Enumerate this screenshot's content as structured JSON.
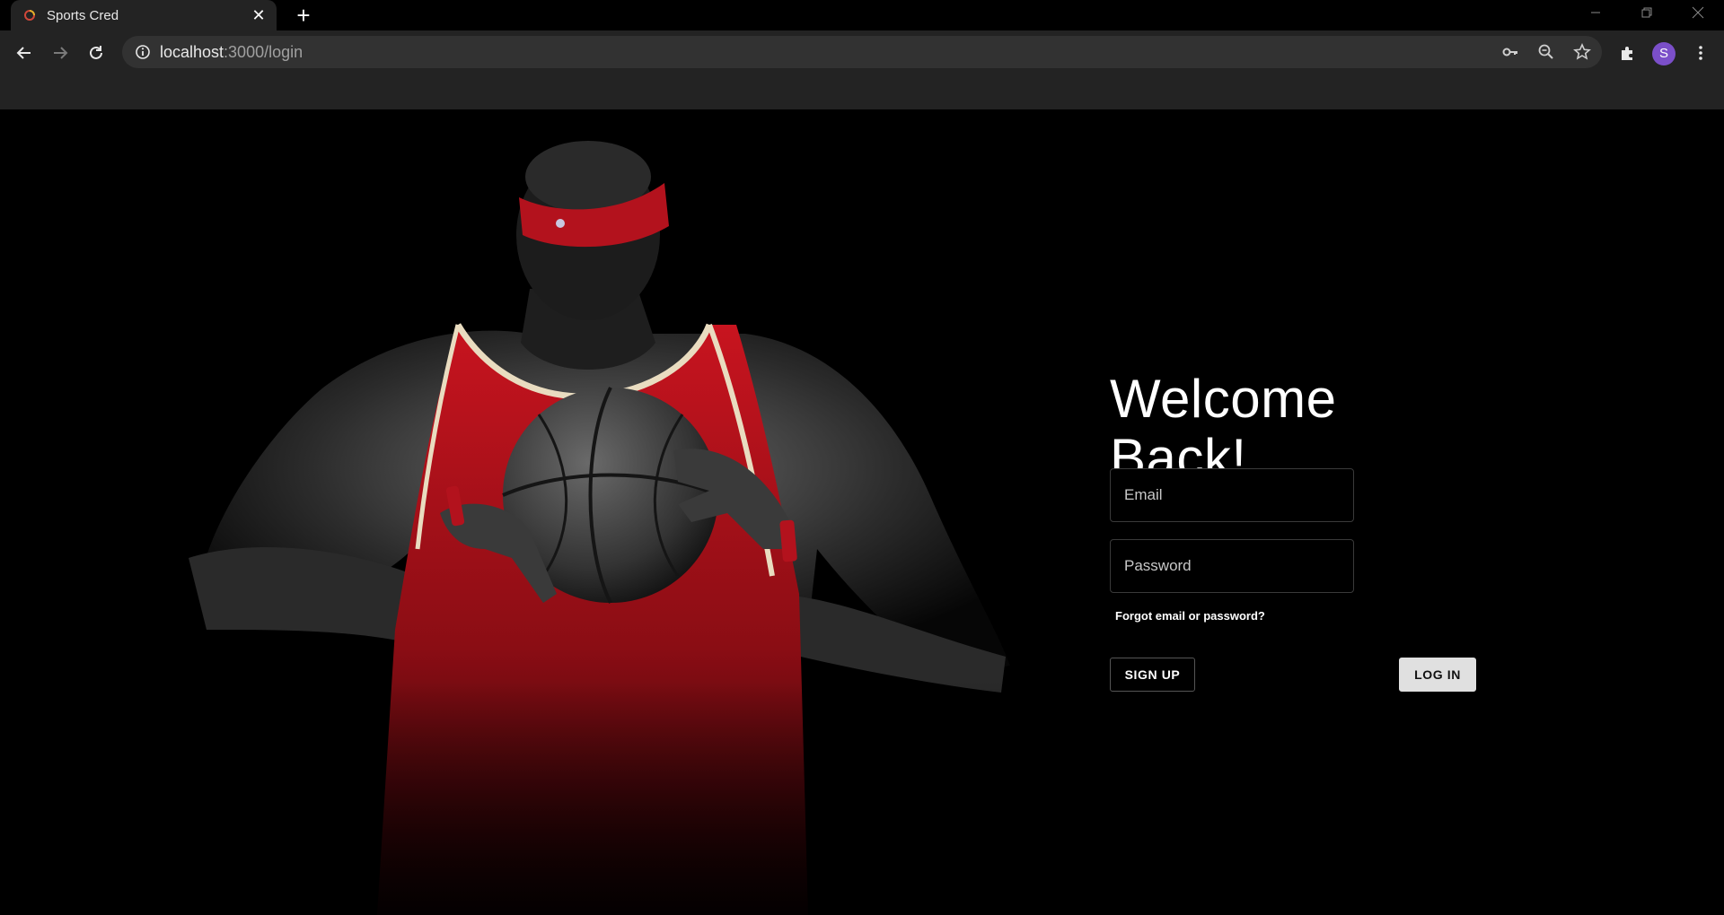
{
  "browser": {
    "tab_title": "Sports Cred",
    "url_host": "localhost",
    "url_path": ":3000/login",
    "profile_initial": "S"
  },
  "login": {
    "heading": "Welcome Back!",
    "email_placeholder": "Email",
    "password_placeholder": "Password",
    "forgot_link": "Forgot email or password?",
    "signup_label": "SIGN UP",
    "login_label": "LOG IN"
  },
  "colors": {
    "page_background": "#000000",
    "jersey_red": "#b3121d",
    "login_button_bg": "#e0e0e0",
    "avatar": "#7b4fc9"
  }
}
